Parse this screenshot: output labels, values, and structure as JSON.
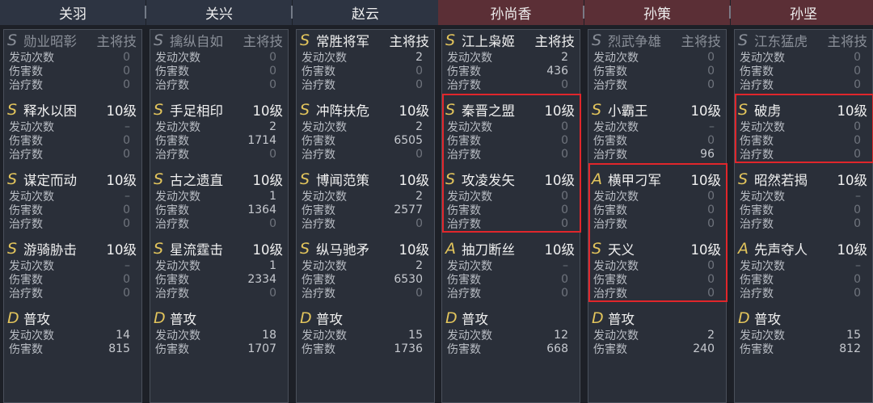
{
  "stat_labels": {
    "triggers": "发动次数",
    "damage": "伤害数",
    "heal": "治疗数"
  },
  "colors": {
    "highlight_box": "#e0262b",
    "grade_gold": "#e3c55c",
    "wei_header": "#2d3442",
    "wu_header": "#5b2f36"
  },
  "generals": [
    {
      "name": "关羽",
      "faction": "wei",
      "skills": [
        {
          "grade": "S",
          "name": "勋业昭彰",
          "level": "主将技",
          "dim": true,
          "triggers": "0",
          "damage": "0",
          "heal": "0"
        },
        {
          "grade": "S",
          "name": "释水以困",
          "level": "10级",
          "triggers": "–",
          "damage": "0",
          "heal": "0"
        },
        {
          "grade": "S",
          "name": "谋定而动",
          "level": "10级",
          "triggers": "–",
          "damage": "0",
          "heal": "0"
        },
        {
          "grade": "S",
          "name": "游骑胁击",
          "level": "10级",
          "triggers": "–",
          "damage": "0",
          "heal": "0"
        },
        {
          "grade": "D",
          "name": "普攻",
          "level": "",
          "triggers": "14",
          "damage": "815"
        }
      ]
    },
    {
      "name": "关兴",
      "faction": "wei",
      "skills": [
        {
          "grade": "S",
          "name": "擒纵自如",
          "level": "主将技",
          "dim": true,
          "triggers": "0",
          "damage": "0",
          "heal": "0"
        },
        {
          "grade": "S",
          "name": "手足相印",
          "level": "10级",
          "triggers": "2",
          "damage": "1714",
          "heal": "0"
        },
        {
          "grade": "S",
          "name": "古之遗直",
          "level": "10级",
          "triggers": "1",
          "damage": "1364",
          "heal": "0"
        },
        {
          "grade": "S",
          "name": "星流霆击",
          "level": "10级",
          "triggers": "1",
          "damage": "2334",
          "heal": "0"
        },
        {
          "grade": "D",
          "name": "普攻",
          "level": "",
          "triggers": "18",
          "damage": "1707"
        }
      ]
    },
    {
      "name": "赵云",
      "faction": "wei",
      "skills": [
        {
          "grade": "S",
          "name": "常胜将军",
          "level": "主将技",
          "triggers": "2",
          "damage": "0",
          "heal": "0"
        },
        {
          "grade": "S",
          "name": "冲阵扶危",
          "level": "10级",
          "triggers": "2",
          "damage": "6505",
          "heal": "0"
        },
        {
          "grade": "S",
          "name": "博闻范策",
          "level": "10级",
          "triggers": "2",
          "damage": "2577",
          "heal": "0"
        },
        {
          "grade": "S",
          "name": "纵马驰矛",
          "level": "10级",
          "triggers": "2",
          "damage": "6530",
          "heal": "0"
        },
        {
          "grade": "D",
          "name": "普攻",
          "level": "",
          "triggers": "15",
          "damage": "1736"
        }
      ]
    },
    {
      "name": "孙尚香",
      "faction": "wu",
      "skills": [
        {
          "grade": "S",
          "name": "江上枭姬",
          "level": "主将技",
          "triggers": "2",
          "damage": "436",
          "heal": "0"
        },
        {
          "grade": "S",
          "name": "秦晋之盟",
          "level": "10级",
          "triggers": "0",
          "damage": "0",
          "heal": "0"
        },
        {
          "grade": "S",
          "name": "攻凌发矢",
          "level": "10级",
          "triggers": "0",
          "damage": "0",
          "heal": "0"
        },
        {
          "grade": "A",
          "name": "抽刀断丝",
          "level": "10级",
          "triggers": "–",
          "damage": "0",
          "heal": "0"
        },
        {
          "grade": "D",
          "name": "普攻",
          "level": "",
          "triggers": "12",
          "damage": "668"
        }
      ]
    },
    {
      "name": "孙策",
      "faction": "wu",
      "skills": [
        {
          "grade": "S",
          "name": "烈武争雄",
          "level": "主将技",
          "dim": true,
          "triggers": "0",
          "damage": "0",
          "heal": "0"
        },
        {
          "grade": "S",
          "name": "小霸王",
          "level": "10级",
          "triggers": "–",
          "damage": "0",
          "heal": "96"
        },
        {
          "grade": "A",
          "name": "横甲刁军",
          "level": "10级",
          "triggers": "0",
          "damage": "0",
          "heal": "0"
        },
        {
          "grade": "S",
          "name": "天义",
          "level": "10级",
          "triggers": "0",
          "damage": "0",
          "heal": "0"
        },
        {
          "grade": "D",
          "name": "普攻",
          "level": "",
          "triggers": "2",
          "damage": "240"
        }
      ]
    },
    {
      "name": "孙坚",
      "faction": "wu",
      "skills": [
        {
          "grade": "S",
          "name": "江东猛虎",
          "level": "主将技",
          "dim": true,
          "triggers": "0",
          "damage": "0",
          "heal": "0"
        },
        {
          "grade": "S",
          "name": "破虏",
          "level": "10级",
          "triggers": "0",
          "damage": "0",
          "heal": "0"
        },
        {
          "grade": "S",
          "name": "昭然若揭",
          "level": "10级",
          "triggers": "–",
          "damage": "0",
          "heal": "0"
        },
        {
          "grade": "A",
          "name": "先声夺人",
          "level": "10级",
          "triggers": "–",
          "damage": "0",
          "heal": "0"
        },
        {
          "grade": "D",
          "name": "普攻",
          "level": "",
          "triggers": "15",
          "damage": "812"
        }
      ]
    }
  ]
}
